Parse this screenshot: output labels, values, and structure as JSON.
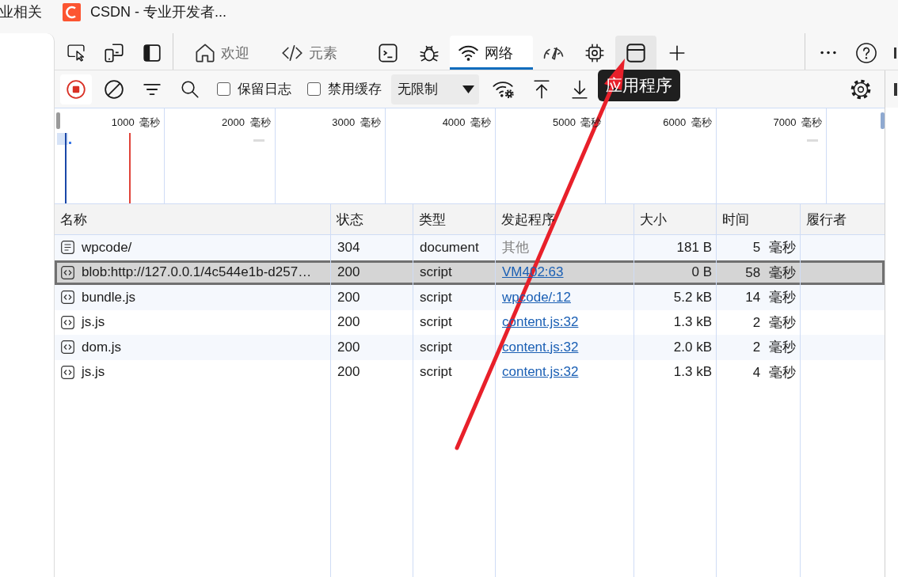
{
  "browser_tabs": [
    {
      "title": "业相关",
      "icon": false
    },
    {
      "title": "CSDN - 专业开发者...",
      "icon": true
    }
  ],
  "devtools_tabs": [
    {
      "kind": "welcome",
      "label": "欢迎",
      "selected": false,
      "hovered": false
    },
    {
      "kind": "elements",
      "label": "元素",
      "selected": false,
      "hovered": false
    },
    {
      "kind": "console",
      "selected": false,
      "hovered": false
    },
    {
      "kind": "sources",
      "selected": false,
      "hovered": false
    },
    {
      "kind": "network",
      "label": "网络",
      "selected": true,
      "hovered": false
    },
    {
      "kind": "performance",
      "selected": false,
      "hovered": false
    },
    {
      "kind": "memory",
      "selected": false,
      "hovered": false
    },
    {
      "kind": "application",
      "selected": false,
      "hovered": true
    }
  ],
  "tooltip": {
    "text": "应用程序"
  },
  "network_toolbar": {
    "recording": true,
    "checkboxes": [
      {
        "label": "保留日志",
        "checked": false
      },
      {
        "label": "禁用缓存",
        "checked": false
      }
    ],
    "throttling": {
      "value": "无限制"
    }
  },
  "overview": {
    "ticks": [
      "1000 毫秒",
      "2000 毫秒",
      "3000 毫秒",
      "4000 毫秒",
      "5000 毫秒",
      "6000 毫秒",
      "7000 毫秒"
    ]
  },
  "table": {
    "columns": [
      "名称",
      "状态",
      "类型",
      "发起程序",
      "大小",
      "时间",
      "履行者"
    ],
    "rows": [
      {
        "kind": "document",
        "name": "wpcode/",
        "status": "304",
        "type": "document",
        "initiator": {
          "text": "其他",
          "link": false
        },
        "size": "181 B",
        "time": "5 毫秒",
        "selected": false
      },
      {
        "kind": "script",
        "name": "blob:http://127.0.0.1/4c544e1b-d257…",
        "status": "200",
        "type": "script",
        "initiator": {
          "text": "VM402:63",
          "link": true
        },
        "size": "0 B",
        "time": "58 毫秒",
        "selected": true
      },
      {
        "kind": "script",
        "name": "bundle.js",
        "status": "200",
        "type": "script",
        "initiator": {
          "text": "wpcode/:12",
          "link": true
        },
        "size": "5.2 kB",
        "time": "14 毫秒",
        "selected": false
      },
      {
        "kind": "script",
        "name": "js.js",
        "status": "200",
        "type": "script",
        "initiator": {
          "text": "content.js:32",
          "link": true
        },
        "size": "1.3 kB",
        "time": "2 毫秒",
        "selected": false
      },
      {
        "kind": "script",
        "name": "dom.js",
        "status": "200",
        "type": "script",
        "initiator": {
          "text": "content.js:32",
          "link": true
        },
        "size": "2.0 kB",
        "time": "2 毫秒",
        "selected": false
      },
      {
        "kind": "script",
        "name": "js.js",
        "status": "200",
        "type": "script",
        "initiator": {
          "text": "content.js:32",
          "link": true
        },
        "size": "1.3 kB",
        "time": "4 毫秒",
        "selected": false
      }
    ]
  },
  "annotations": [
    {
      "kind": "arrow"
    }
  ]
}
